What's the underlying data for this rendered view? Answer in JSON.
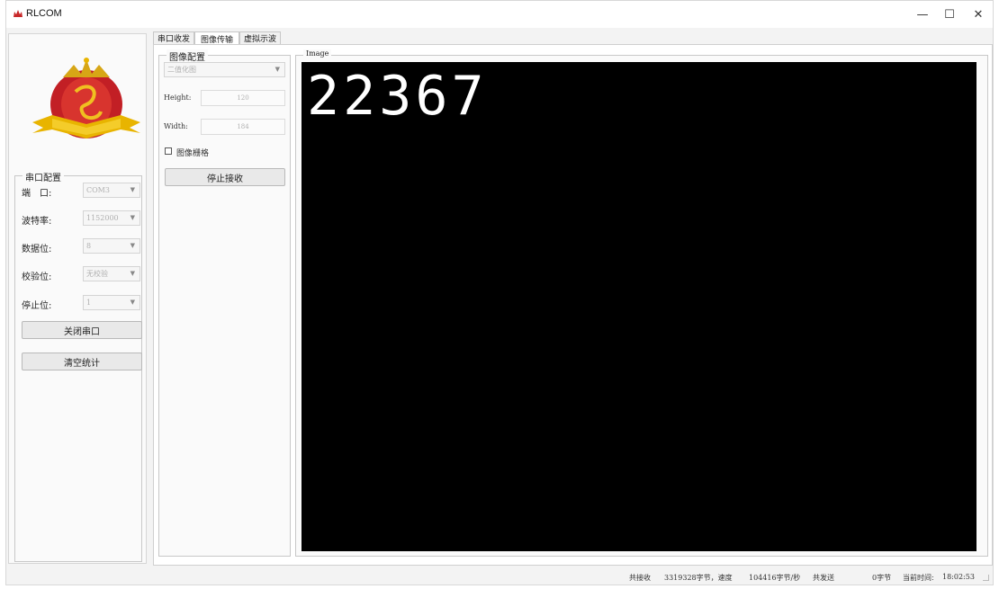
{
  "window": {
    "title": "RLCOM",
    "controls": {
      "minimize": "—",
      "maximize": "☐",
      "close": "✕"
    }
  },
  "serial_config": {
    "group_title": "串口配置",
    "port": {
      "label": "端　口:",
      "value": "COM3"
    },
    "baud": {
      "label": "波特率:",
      "value": "1152000"
    },
    "data_bits": {
      "label": "数据位:",
      "value": "8"
    },
    "parity": {
      "label": "校验位:",
      "value": "无校验"
    },
    "stop_bits": {
      "label": "停止位:",
      "value": "1"
    },
    "close_port_label": "关闭串口",
    "clear_stats_label": "清空统计"
  },
  "tabs": [
    {
      "label": "串口收发",
      "active": false
    },
    {
      "label": "图像传输",
      "active": true
    },
    {
      "label": "虚拟示波",
      "active": false
    }
  ],
  "image_config": {
    "group_title": "图像配置",
    "mode": "二值化图",
    "height_label": "Height:",
    "height_value": "120",
    "width_label": "Width:",
    "width_value": "184",
    "grid_label": "图像栅格",
    "grid_checked": false,
    "stop_receive_label": "停止接收"
  },
  "image_panel": {
    "group_title": "Image",
    "displayed_text": "22367"
  },
  "status": {
    "received_label": "共接收",
    "received_value": "3319328字节，速度",
    "speed_value": "104416字节/秒",
    "sent_label": "共发送",
    "sent_value": "0字节",
    "time_label": "当前时间:",
    "time_value": "18:02:53"
  },
  "colors": {
    "accent_logo": "#c8282a",
    "gold": "#e8b400",
    "canvas_bg": "#000000"
  }
}
